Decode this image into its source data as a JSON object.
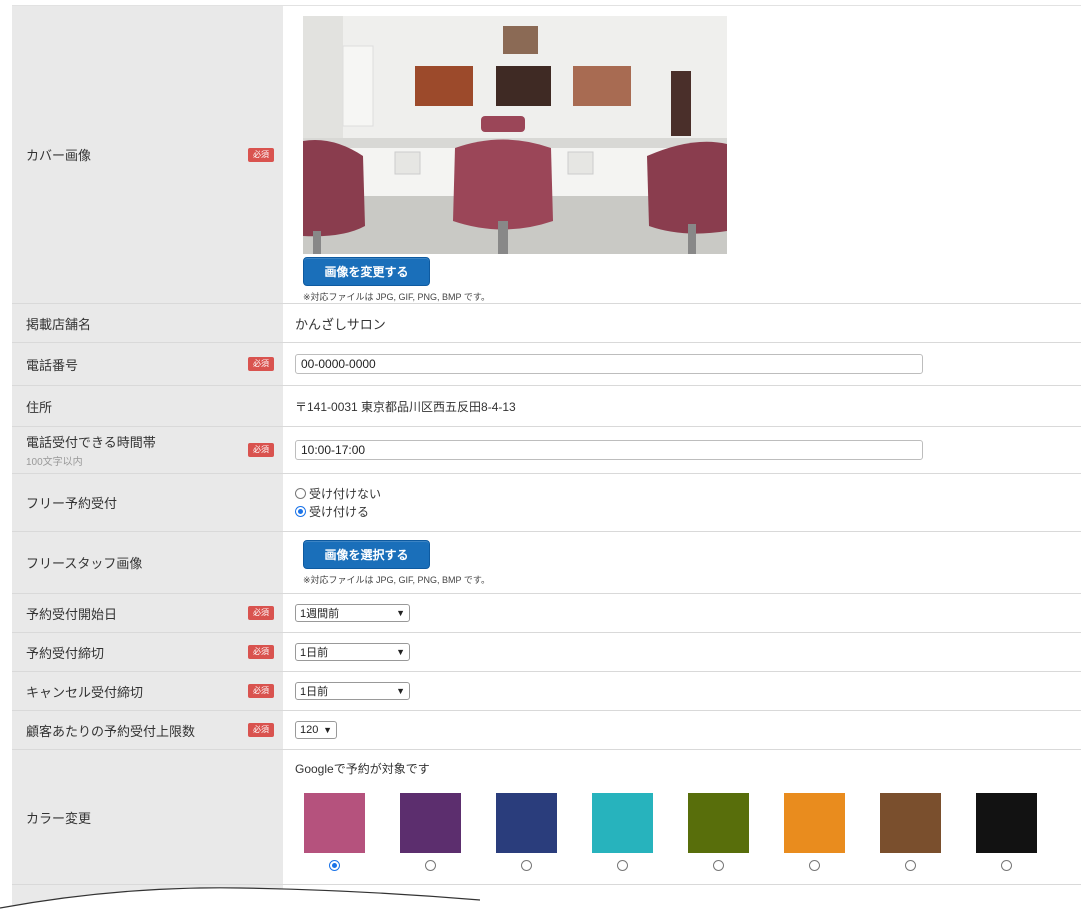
{
  "required_label": "必須",
  "cover": {
    "label": "カバー画像",
    "button": "画像を変更する",
    "note": "※対応ファイルは JPG, GIF, PNG, BMP です。"
  },
  "store_name": {
    "label": "掲載店舗名",
    "value": "かんざしサロン"
  },
  "phone": {
    "label": "電話番号",
    "value": "00-0000-0000"
  },
  "address": {
    "label": "住所",
    "value": "〒141-0031 東京都品川区西五反田8-4-13"
  },
  "phone_hours": {
    "label": "電話受付できる時間帯",
    "sub": "100文字以内",
    "value": "10:00-17:00"
  },
  "free_booking": {
    "label": "フリー予約受付",
    "options": [
      "受け付けない",
      "受け付ける"
    ],
    "selected": 1
  },
  "free_staff_image": {
    "label": "フリースタッフ画像",
    "button": "画像を選択する",
    "note": "※対応ファイルは JPG, GIF, PNG, BMP です。"
  },
  "booking_start": {
    "label": "予約受付開始日",
    "value": "1週間前"
  },
  "booking_deadline": {
    "label": "予約受付締切",
    "value": "1日前"
  },
  "cancel_deadline": {
    "label": "キャンセル受付締切",
    "value": "1日前"
  },
  "booking_limit": {
    "label": "顧客あたりの予約受付上限数",
    "value": "120"
  },
  "color": {
    "label": "カラー変更",
    "note": "Googleで予約が対象です",
    "swatches": [
      "#b5527d",
      "#5c2e6e",
      "#2a3d7c",
      "#27b3bd",
      "#586e0b",
      "#e98c1e",
      "#7a4f2d",
      "#121212"
    ],
    "selected": 0
  }
}
